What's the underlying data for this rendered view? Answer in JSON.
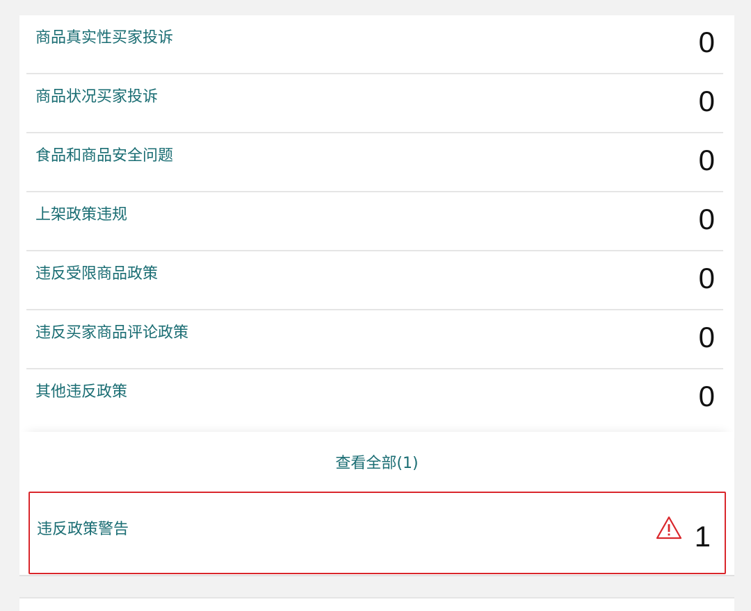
{
  "metrics": [
    {
      "label": "商品真实性买家投诉",
      "count": "0"
    },
    {
      "label": "商品状况买家投诉",
      "count": "0"
    },
    {
      "label": "食品和商品安全问题",
      "count": "0"
    },
    {
      "label": "上架政策违规",
      "count": "0"
    },
    {
      "label": "违反受限商品政策",
      "count": "0"
    },
    {
      "label": "违反买家商品评论政策",
      "count": "0"
    },
    {
      "label": "其他违反政策",
      "count": "0"
    }
  ],
  "view_all_label": "查看全部(1)",
  "warning": {
    "label": "违反政策警告",
    "count": "1",
    "icon": "warning-triangle-icon",
    "highlight_color": "#d9262b"
  },
  "colors": {
    "link": "#1a6d73",
    "count": "#111111",
    "background": "#f2f2f2"
  }
}
